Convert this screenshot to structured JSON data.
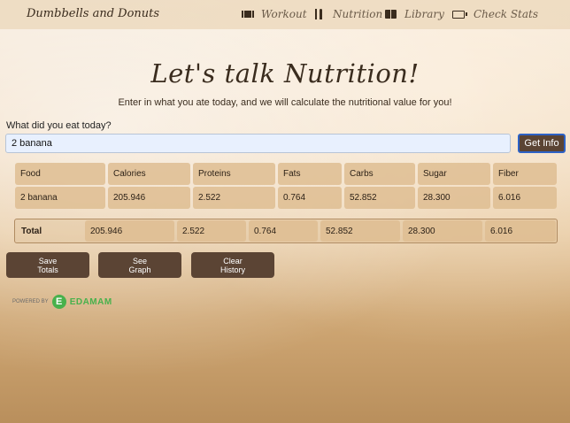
{
  "nav": {
    "brand": "Dumbbells and Donuts",
    "items": [
      {
        "label": "Workout",
        "icon": "dumbbell-icon"
      },
      {
        "label": "Nutrition",
        "icon": "utensils-icon"
      },
      {
        "label": "Library",
        "icon": "book-icon"
      },
      {
        "label": "Check Stats",
        "icon": "battery-icon"
      }
    ]
  },
  "main": {
    "heading": "Let's talk Nutrition!",
    "subheading": "Enter in what you ate today, and we will calculate the nutritional value for you!",
    "question": "What did you eat today?",
    "input_value": "2 banana",
    "get_info_label": "Get Info"
  },
  "table": {
    "headers": [
      "Food",
      "Calories",
      "Proteins",
      "Fats",
      "Carbs",
      "Sugar",
      "Fiber"
    ],
    "rows": [
      [
        "2 banana",
        "205.946",
        "2.522",
        "0.764",
        "52.852",
        "28.300",
        "6.016"
      ]
    ],
    "totals": {
      "label": "Total",
      "values": [
        "205.946",
        "2.522",
        "0.764",
        "52.852",
        "28.300",
        "6.016"
      ]
    }
  },
  "actions": {
    "save_totals": "Save\nTotals",
    "see_graph": "See\nGraph",
    "clear_history": "Clear\nHistory"
  },
  "footer": {
    "powered_by": "POWERED BY",
    "edamam_letter": "E",
    "edamam_name": "EDAMAM"
  },
  "colors": {
    "button_bg": "#5b4434",
    "cell_bg": "#debd92",
    "input_bg": "#e8f0fe",
    "edamam_green": "#48b14c"
  }
}
